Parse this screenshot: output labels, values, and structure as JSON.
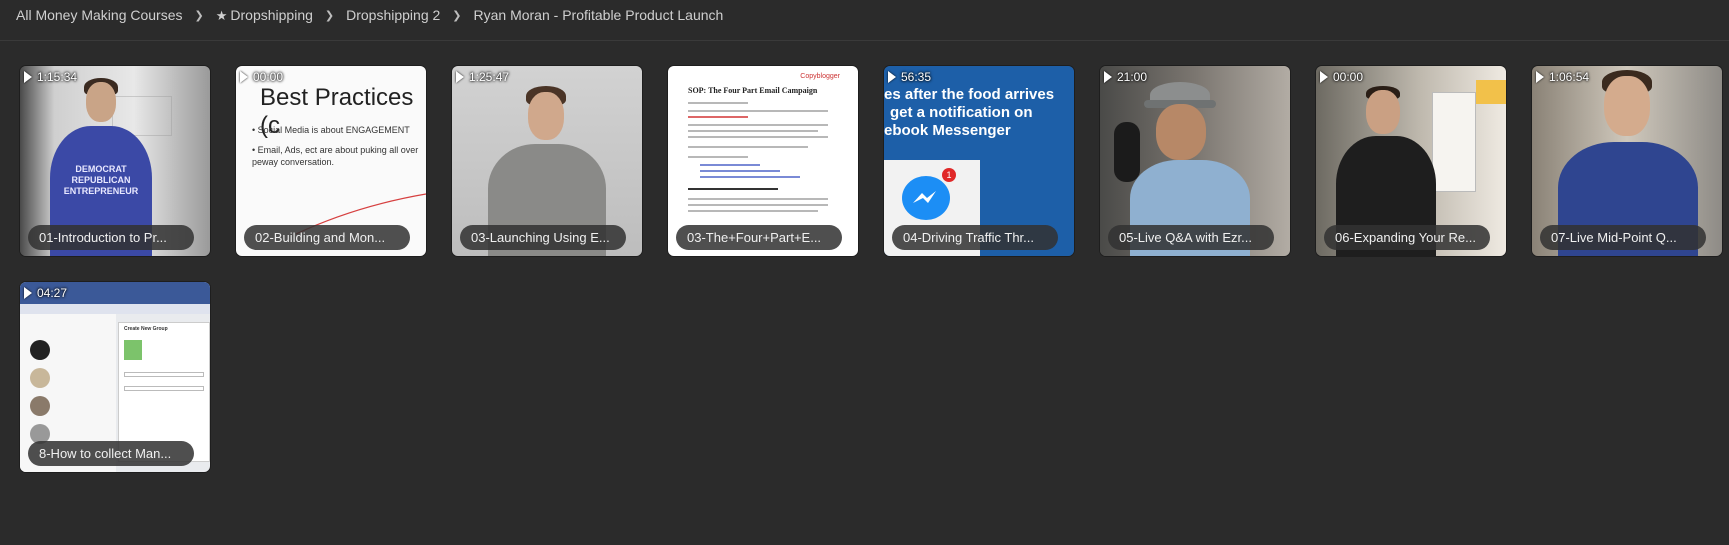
{
  "breadcrumb": {
    "items": [
      {
        "label": "All Money Making Courses",
        "starred": false
      },
      {
        "label": "Dropshipping",
        "starred": true
      },
      {
        "label": "Dropshipping 2",
        "starred": false
      },
      {
        "label": "Ryan Moran - Profitable Product Launch",
        "starred": false
      }
    ],
    "separator": "❯",
    "star": "★"
  },
  "videos": [
    {
      "duration": "1:15:34",
      "title": "01-Introduction to Pr...",
      "thumb": "intro"
    },
    {
      "duration": "00:00",
      "title": "02-Building and Mon...",
      "thumb": "slide"
    },
    {
      "duration": "1:25:47",
      "title": "03-Launching Using E...",
      "thumb": "man-grey"
    },
    {
      "duration": "",
      "title": "03-The+Four+Part+E...",
      "thumb": "doc"
    },
    {
      "duration": "56:35",
      "title": "04-Driving Traffic Thr...",
      "thumb": "messenger"
    },
    {
      "duration": "21:00",
      "title": "05-Live Q&A with Ezr...",
      "thumb": "cap-man"
    },
    {
      "duration": "00:00",
      "title": "06-Expanding Your Re...",
      "thumb": "whiteboard"
    },
    {
      "duration": "1:06:54",
      "title": "07-Live Mid-Point Q...",
      "thumb": "blue-man"
    },
    {
      "duration": "04:27",
      "title": "8-How to collect Man...",
      "thumb": "facebook"
    }
  ],
  "thumb_text": {
    "slide_title": "Best Practices (c",
    "slide_bullet1": "• Social Media is about ENGAGEMENT",
    "slide_bullet2": "• Email, Ads, ect are about puking all over pe",
    "slide_bullet2b": "way conversation.",
    "doc_title": "SOP: The Four Part Email Campaign",
    "doc_logo": "Copyblogger",
    "messenger_line1": "es after the food arrives",
    "messenger_line2": "get a notification on",
    "messenger_line3": "ebook Messenger",
    "messenger_badge": "1",
    "shirt_text": "DEMOCRAT REPUBLICAN ENTREPRENEUR",
    "fb_panel_title": "Create New Group"
  }
}
